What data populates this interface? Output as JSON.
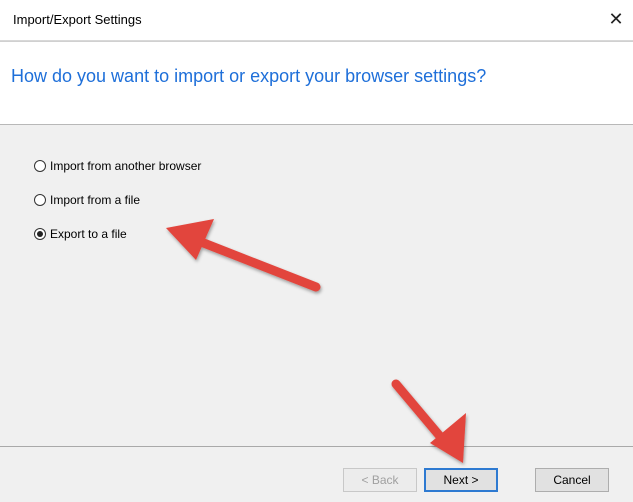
{
  "window": {
    "title": "Import/Export Settings",
    "close_icon": "close-icon"
  },
  "header": {
    "question": "How do you want to import or export your browser settings?"
  },
  "options": [
    {
      "label": "Import from another browser",
      "selected": false
    },
    {
      "label": "Import from a file",
      "selected": false
    },
    {
      "label": "Export to a file",
      "selected": true
    }
  ],
  "buttons": {
    "back": "< Back",
    "next": "Next >",
    "cancel": "Cancel"
  },
  "colors": {
    "accent_text": "#1e6fd9",
    "annotation_arrow": "#e2453c",
    "focus_border": "#2e7ad1"
  }
}
